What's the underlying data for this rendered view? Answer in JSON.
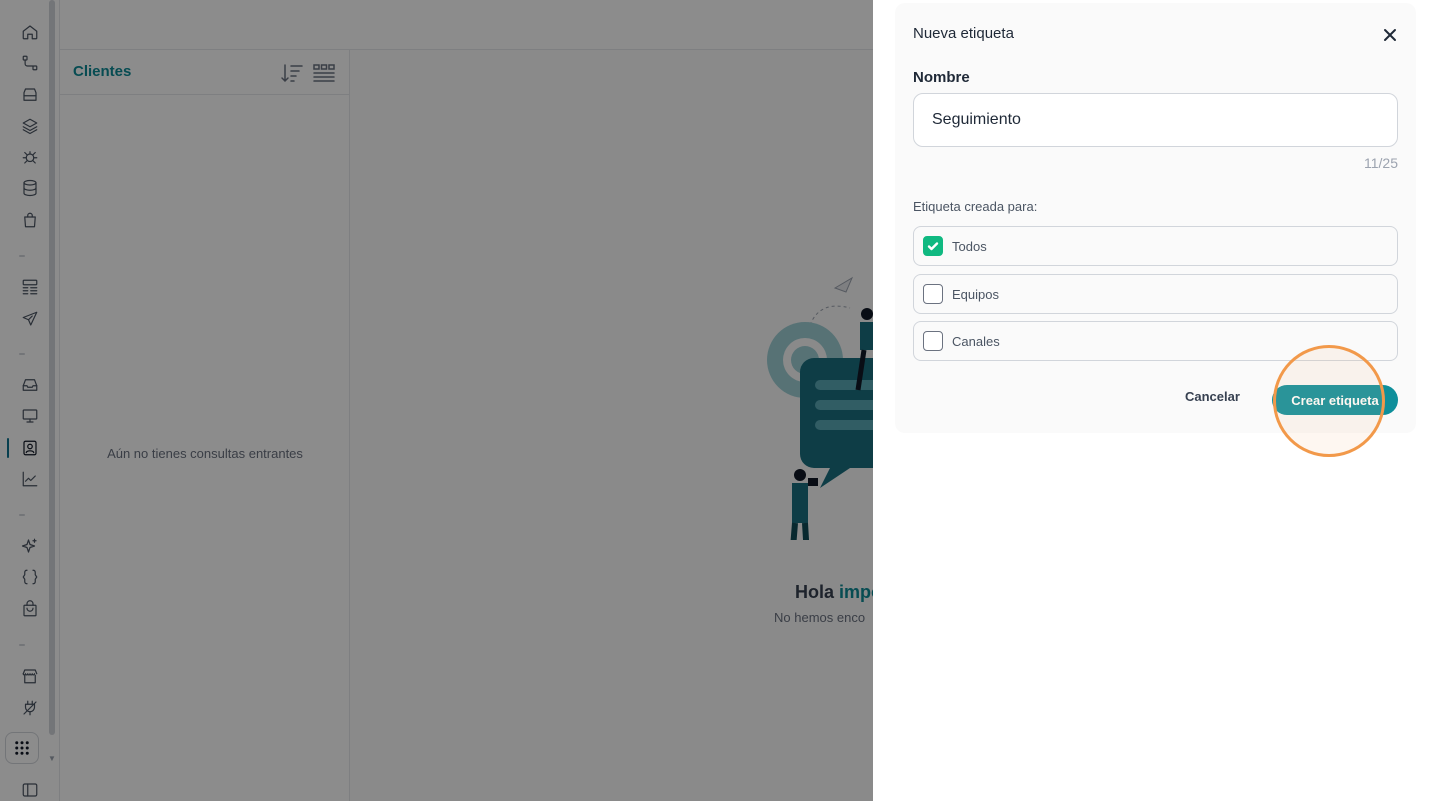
{
  "rail": {
    "icons": [
      "home-icon",
      "flow-icon",
      "archive-icon",
      "layers-icon",
      "bug-icon",
      "database-icon",
      "bag-icon",
      "layout-icon",
      "send-icon",
      "inbox-icon",
      "monitor-icon",
      "contact-icon",
      "chart-icon",
      "sparkle-icon",
      "braces-icon",
      "shopping-bag-icon",
      "store-icon",
      "plug-icon",
      "apps-icon",
      "sidebar-toggle-icon"
    ]
  },
  "clients": {
    "title": "Clientes",
    "empty_message": "Aún no tienes consultas entrantes"
  },
  "main": {
    "greeting_prefix": "Hola",
    "greeting_accent": "impo",
    "subtext": "No hemos enco"
  },
  "modal": {
    "title": "Nueva etiqueta",
    "name_label": "Nombre",
    "name_value": "Seguimiento",
    "counter": "11/25",
    "section_label": "Etiqueta creada para:",
    "options": [
      {
        "label": "Todos",
        "checked": true
      },
      {
        "label": "Equipos",
        "checked": false
      },
      {
        "label": "Canales",
        "checked": false
      }
    ],
    "cancel_label": "Cancelar",
    "create_label": "Crear etiqueta"
  },
  "colors": {
    "accent": "#0e8f9b",
    "check": "#10b981",
    "highlight": "#f2994a"
  }
}
